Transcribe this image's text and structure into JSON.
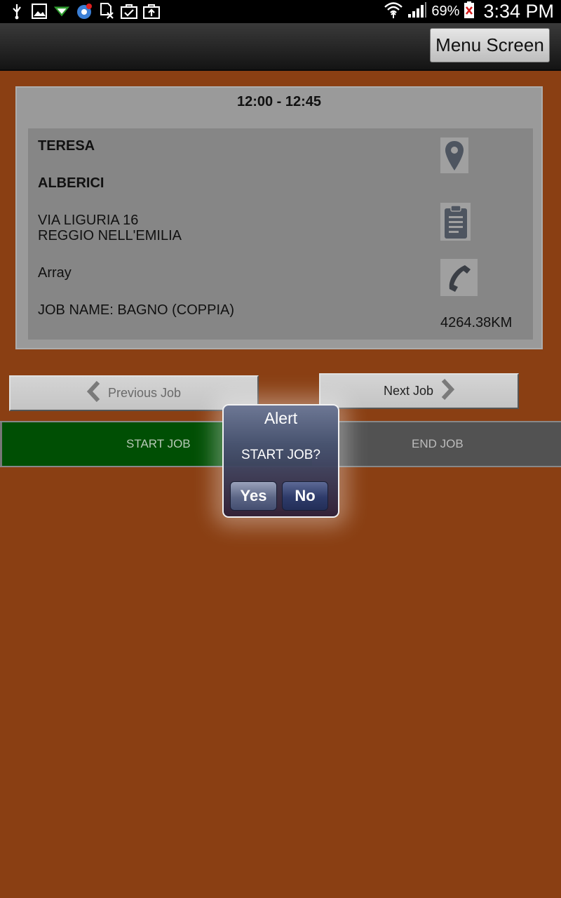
{
  "status_bar": {
    "icons": [
      "usb-icon",
      "image-icon",
      "download-icon",
      "chrome-notification-icon",
      "sim-icon",
      "briefcase-check-icon",
      "briefcase-upload-icon"
    ],
    "battery_percent": "69%",
    "time": "3:34 PM"
  },
  "action_bar": {
    "menu_button_label": "Menu Screen"
  },
  "job": {
    "time_range": "12:00 - 12:45",
    "first_name": "TERESA",
    "last_name": "ALBERICI",
    "address_line1": "VIA LIGURIA 16",
    "address_line2": "REGGIO NELL'EMILIA",
    "phone_text": "Array",
    "job_name": "JOB NAME: BAGNO (COPPIA)",
    "distance": "4264.38KM"
  },
  "nav": {
    "previous_label": "Previous Job",
    "next_label": "Next Job"
  },
  "actions": {
    "start_label": "START JOB",
    "end_label": "END JOB"
  },
  "alert": {
    "title": "Alert",
    "message": "START JOB?",
    "yes_label": "Yes",
    "no_label": "No"
  },
  "colors": {
    "background": "#8a3f13",
    "start_job": "#004f04",
    "end_job": "#525252",
    "card": "#9a9a9a"
  }
}
